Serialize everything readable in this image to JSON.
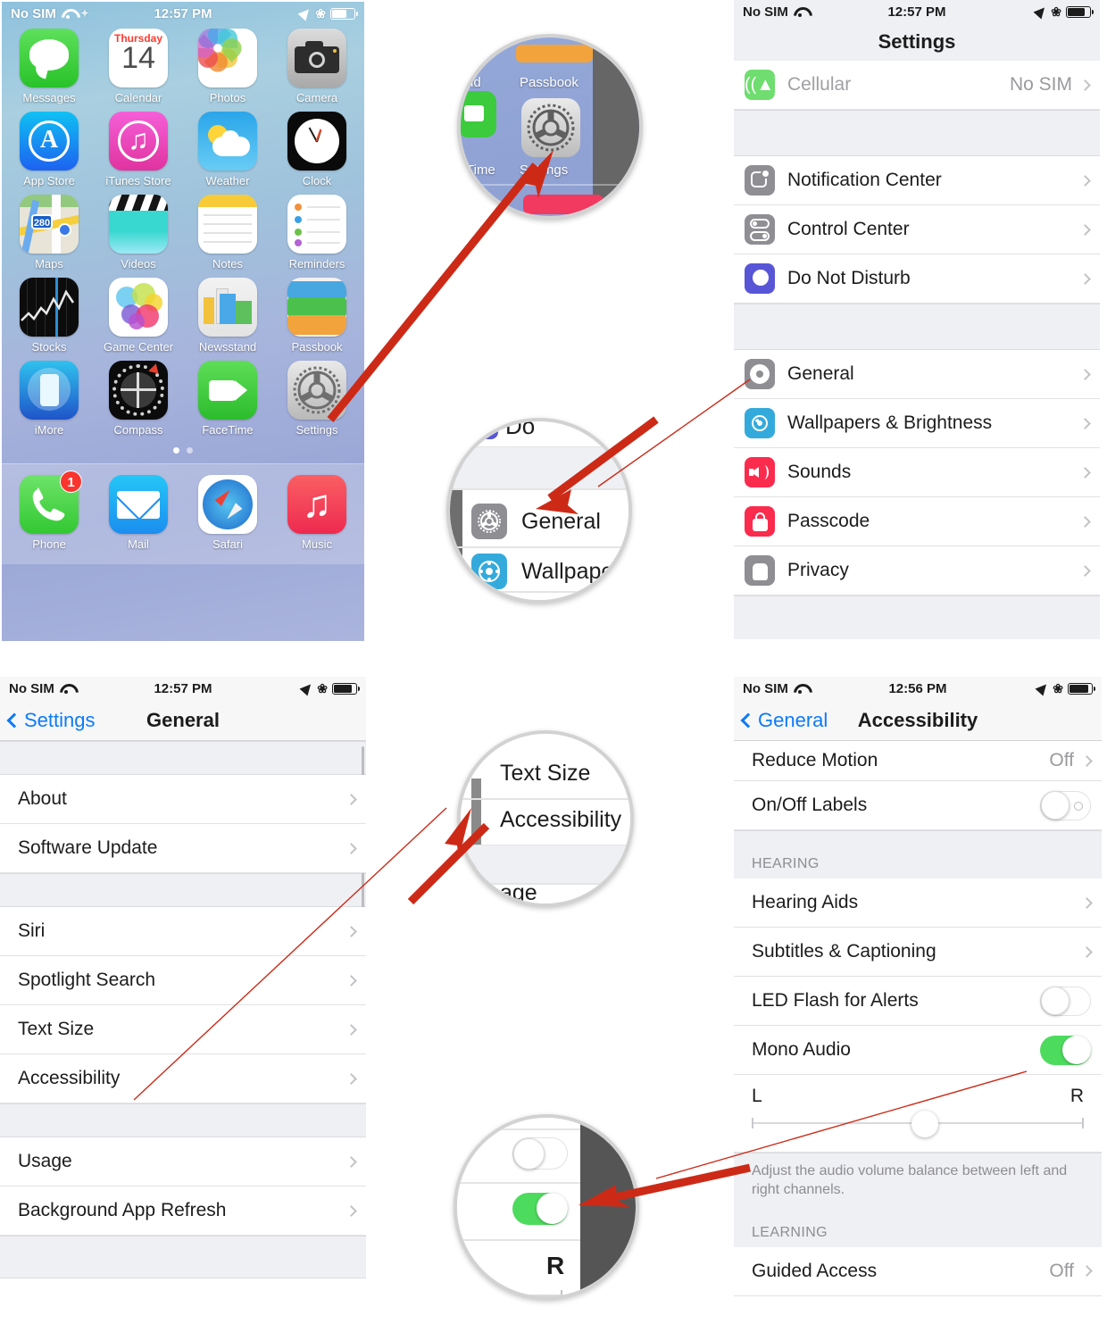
{
  "home_screen": {
    "status": {
      "carrier": "No SIM",
      "time": "12:57 PM"
    },
    "rows": [
      [
        {
          "label": "Messages",
          "icon": "messages-icon"
        },
        {
          "label": "Calendar",
          "icon": "calendar-icon",
          "day": "Thursday",
          "date": "14"
        },
        {
          "label": "Photos",
          "icon": "photos-icon"
        },
        {
          "label": "Camera",
          "icon": "camera-icon"
        }
      ],
      [
        {
          "label": "App Store",
          "icon": "app-store-icon",
          "glyph": "A"
        },
        {
          "label": "iTunes Store",
          "icon": "itunes-store-icon",
          "glyph": "♫"
        },
        {
          "label": "Weather",
          "icon": "weather-icon"
        },
        {
          "label": "Clock",
          "icon": "clock-icon"
        }
      ],
      [
        {
          "label": "Maps",
          "icon": "maps-icon",
          "glyph": "280"
        },
        {
          "label": "Videos",
          "icon": "videos-icon"
        },
        {
          "label": "Notes",
          "icon": "notes-icon"
        },
        {
          "label": "Reminders",
          "icon": "reminders-icon"
        }
      ],
      [
        {
          "label": "Stocks",
          "icon": "stocks-icon"
        },
        {
          "label": "Game Center",
          "icon": "game-center-icon"
        },
        {
          "label": "Newsstand",
          "icon": "newsstand-icon"
        },
        {
          "label": "Passbook",
          "icon": "passbook-icon"
        }
      ],
      [
        {
          "label": "iMore",
          "icon": "imore-icon"
        },
        {
          "label": "Compass",
          "icon": "compass-icon"
        },
        {
          "label": "FaceTime",
          "icon": "facetime-icon"
        },
        {
          "label": "Settings",
          "icon": "settings-gear-icon"
        }
      ]
    ],
    "dock": [
      {
        "label": "Phone",
        "icon": "phone-icon",
        "badge": "1"
      },
      {
        "label": "Mail",
        "icon": "mail-icon"
      },
      {
        "label": "Safari",
        "icon": "safari-icon"
      },
      {
        "label": "Music",
        "icon": "music-icon",
        "glyph": "♫"
      }
    ],
    "page_dots": 2,
    "active_dot": 0
  },
  "settings_screen": {
    "status": {
      "carrier": "No SIM",
      "time": "12:57 PM"
    },
    "title": "Settings",
    "group1": [
      {
        "label": "Cellular",
        "value": "No SIM",
        "icon": "cellular-icon",
        "muted": true
      }
    ],
    "group2": [
      {
        "label": "Notification Center",
        "value": "",
        "icon": "notification-center-icon"
      },
      {
        "label": "Control Center",
        "value": "",
        "icon": "control-center-icon"
      },
      {
        "label": "Do Not Disturb",
        "value": "",
        "icon": "do-not-disturb-icon"
      }
    ],
    "group3": [
      {
        "label": "General",
        "value": "",
        "icon": "general-gear-icon"
      },
      {
        "label": "Wallpapers & Brightness",
        "value": "",
        "icon": "wallpapers-icon"
      },
      {
        "label": "Sounds",
        "value": "",
        "icon": "sounds-icon"
      },
      {
        "label": "Passcode",
        "value": "",
        "icon": "passcode-lock-icon"
      },
      {
        "label": "Privacy",
        "value": "",
        "icon": "privacy-hand-icon"
      }
    ]
  },
  "general_screen": {
    "status": {
      "carrier": "No SIM",
      "time": "12:57 PM"
    },
    "back_label": "Settings",
    "title": "General",
    "group1": [
      {
        "label": "About"
      },
      {
        "label": "Software Update"
      }
    ],
    "group2": [
      {
        "label": "Siri"
      },
      {
        "label": "Spotlight Search"
      },
      {
        "label": "Text Size"
      },
      {
        "label": "Accessibility"
      }
    ],
    "group3": [
      {
        "label": "Usage"
      },
      {
        "label": "Background App Refresh"
      }
    ]
  },
  "accessibility_screen": {
    "status": {
      "carrier": "No SIM",
      "time": "12:56 PM"
    },
    "back_label": "General",
    "title": "Accessibility",
    "top_rows": [
      {
        "label": "Reduce Motion",
        "value": "Off",
        "type": "chevron"
      },
      {
        "label": "On/Off Labels",
        "type": "toggle-labels",
        "state": "off"
      }
    ],
    "hearing_header": "HEARING",
    "hearing_rows": [
      {
        "label": "Hearing Aids",
        "type": "chevron"
      },
      {
        "label": "Subtitles & Captioning",
        "type": "chevron"
      },
      {
        "label": "LED Flash for Alerts",
        "type": "toggle",
        "state": "off"
      },
      {
        "label": "Mono Audio",
        "type": "toggle",
        "state": "on"
      }
    ],
    "balance": {
      "left": "L",
      "right": "R",
      "position_percent": 48
    },
    "footnote": "Adjust the audio volume balance between left and right channels.",
    "learning_header": "LEARNING",
    "learning_rows": [
      {
        "label": "Guided Access",
        "value": "Off",
        "type": "chevron"
      }
    ]
  },
  "callouts": {
    "settings_app": {
      "labels": [
        "nd",
        "Passbook",
        "Time",
        "Settings"
      ],
      "target": "settings-gear-icon"
    },
    "general_row": {
      "labels": [
        "Do",
        "General",
        "Wallpape"
      ],
      "target": "general-row"
    },
    "accessibility_row": {
      "labels": [
        "Text Size",
        "Accessibility",
        "age"
      ],
      "target": "accessibility-row"
    },
    "mono_audio_toggle": {
      "labels": [
        "R"
      ],
      "target": "mono-audio-toggle"
    }
  },
  "colors": {
    "accent_blue": "#0b7bf7",
    "arrow_red": "#cc2a17",
    "toggle_green": "#4ddb5e",
    "group_bg": "#eff0f4"
  }
}
